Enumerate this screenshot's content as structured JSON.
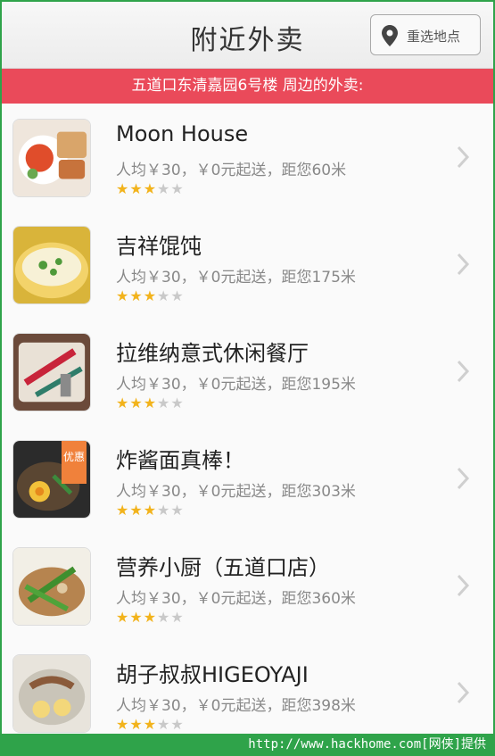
{
  "header": {
    "title": "附近外卖",
    "location_button_label": "重选地点",
    "location_icon": "map-pin-icon"
  },
  "banner": {
    "text": "五道口东清嘉园6号楼 周边的外卖:"
  },
  "restaurants": [
    {
      "name": "Moon House",
      "meta": "人均￥30，￥0元起送，距您60米",
      "rating": 3,
      "rating_max": 5
    },
    {
      "name": "吉祥馄饨",
      "meta": "人均￥30，￥0元起送，距您175米",
      "rating": 3,
      "rating_max": 5
    },
    {
      "name": "拉维纳意式休闲餐厅",
      "meta": "人均￥30，￥0元起送，距您195米",
      "rating": 3,
      "rating_max": 5
    },
    {
      "name": "炸酱面真棒！",
      "meta": "人均￥30，￥0元起送，距您303米",
      "rating": 3,
      "rating_max": 5,
      "badge": "优惠"
    },
    {
      "name": "营养小厨（五道口店）",
      "meta": "人均￥30，￥0元起送，距您360米",
      "rating": 3,
      "rating_max": 5
    },
    {
      "name": "胡子叔叔HIGEOYAJI",
      "meta": "人均￥30，￥0元起送，距您398米",
      "rating": 3,
      "rating_max": 5
    }
  ],
  "footer": {
    "watermark": "http://www.hackhome.com[网侠]提供"
  },
  "colors": {
    "banner": "#ea4a5a",
    "star_on": "#f2b31c",
    "star_off": "#c9c9c9",
    "frame": "#2fa34a"
  }
}
